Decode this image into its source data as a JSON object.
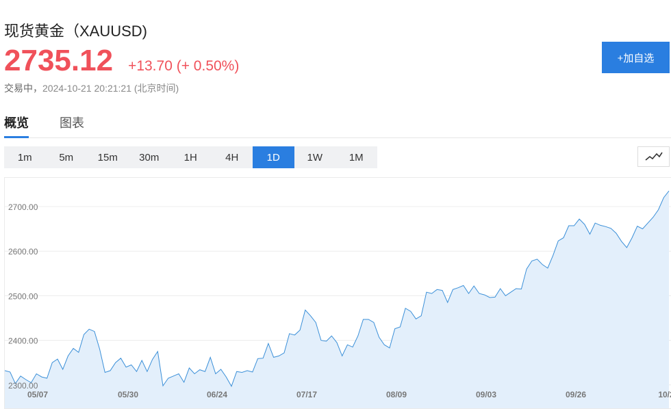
{
  "header": {
    "title": "现货黄金（XAUUSD)",
    "price": "2735.12",
    "change": "+13.70 (+ 0.50%)",
    "status_label": "交易中，",
    "timestamp": "2024-10-21 20:21:21 (北京时间)",
    "add_button_label": "+加自选"
  },
  "tabs": [
    {
      "label": "概览",
      "active": true
    },
    {
      "label": "图表",
      "active": false
    }
  ],
  "intervals": [
    {
      "label": "1m",
      "active": false
    },
    {
      "label": "5m",
      "active": false
    },
    {
      "label": "15m",
      "active": false
    },
    {
      "label": "30m",
      "active": false
    },
    {
      "label": "1H",
      "active": false
    },
    {
      "label": "4H",
      "active": false
    },
    {
      "label": "1D",
      "active": true
    },
    {
      "label": "1W",
      "active": false
    },
    {
      "label": "1M",
      "active": false
    }
  ],
  "chart_type_icon": "line-chart-icon",
  "colors": {
    "up": "#f0515a",
    "accent": "#2a7ee0",
    "line": "#3a8fd8",
    "area": "#e3effb"
  },
  "chart_data": {
    "type": "area",
    "title": "",
    "xlabel": "",
    "ylabel": "",
    "ylim": [
      2300,
      2700
    ],
    "y_ticks": [
      "2700.00",
      "2600.00",
      "2500.00",
      "2400.00",
      "2300.00"
    ],
    "x_tick_labels": [
      "05/07",
      "05/30",
      "06/24",
      "07/17",
      "08/09",
      "09/03",
      "09/26",
      "10/2"
    ],
    "grid": true,
    "values": [
      2332,
      2329,
      2303,
      2320,
      2312,
      2305,
      2325,
      2318,
      2315,
      2350,
      2358,
      2335,
      2365,
      2382,
      2373,
      2413,
      2425,
      2420,
      2380,
      2328,
      2332,
      2350,
      2360,
      2340,
      2345,
      2330,
      2355,
      2330,
      2357,
      2375,
      2298,
      2315,
      2320,
      2325,
      2306,
      2338,
      2325,
      2334,
      2330,
      2362,
      2325,
      2335,
      2318,
      2297,
      2330,
      2328,
      2332,
      2329,
      2359,
      2360,
      2393,
      2362,
      2365,
      2372,
      2415,
      2412,
      2423,
      2468,
      2455,
      2440,
      2400,
      2398,
      2410,
      2395,
      2365,
      2390,
      2385,
      2410,
      2447,
      2447,
      2440,
      2407,
      2390,
      2383,
      2426,
      2430,
      2472,
      2465,
      2448,
      2455,
      2508,
      2505,
      2514,
      2512,
      2485,
      2514,
      2518,
      2523,
      2505,
      2522,
      2505,
      2502,
      2496,
      2497,
      2516,
      2500,
      2508,
      2516,
      2515,
      2560,
      2578,
      2582,
      2570,
      2562,
      2590,
      2623,
      2630,
      2657,
      2657,
      2672,
      2660,
      2638,
      2663,
      2658,
      2655,
      2651,
      2640,
      2622,
      2608,
      2630,
      2656,
      2650,
      2663,
      2676,
      2693,
      2720,
      2735
    ]
  }
}
